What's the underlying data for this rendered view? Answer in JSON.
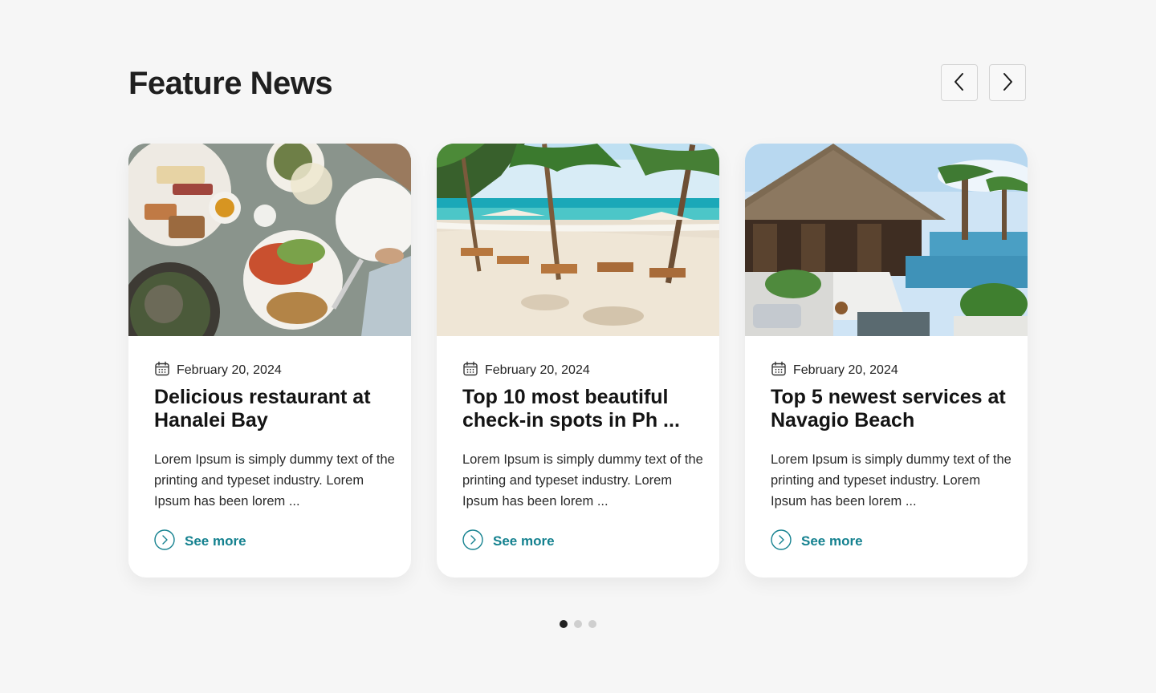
{
  "section": {
    "title": "Feature News"
  },
  "colors": {
    "accent": "#14818f",
    "background": "#f6f6f6",
    "card": "#ffffff"
  },
  "navigation": {
    "prev_icon": "chevron-left-icon",
    "next_icon": "chevron-right-icon"
  },
  "cards": [
    {
      "image": "restaurant-food-table",
      "date": "February 20, 2024",
      "title": "Delicious restaurant at Hanalei Bay",
      "description": "Lorem Ipsum is simply dummy text of the printing and typeset industry. Lorem Ipsum has been lorem ...",
      "link_label": "See more"
    },
    {
      "image": "tropical-beach-palms",
      "date": "February 20, 2024",
      "title": "Top 10 most beautiful check-in spots in Ph ...",
      "description": "Lorem Ipsum is simply dummy text of the printing and typeset industry. Lorem Ipsum has been lorem ...",
      "link_label": "See more"
    },
    {
      "image": "resort-pool-thatched-hut",
      "date": "February 20, 2024",
      "title": "Top 5 newest services at Navagio Beach",
      "description": "Lorem Ipsum is simply dummy text of the printing and typeset industry. Lorem Ipsum has been lorem ...",
      "link_label": "See more"
    }
  ],
  "pagination": {
    "total": 3,
    "active_index": 0
  }
}
